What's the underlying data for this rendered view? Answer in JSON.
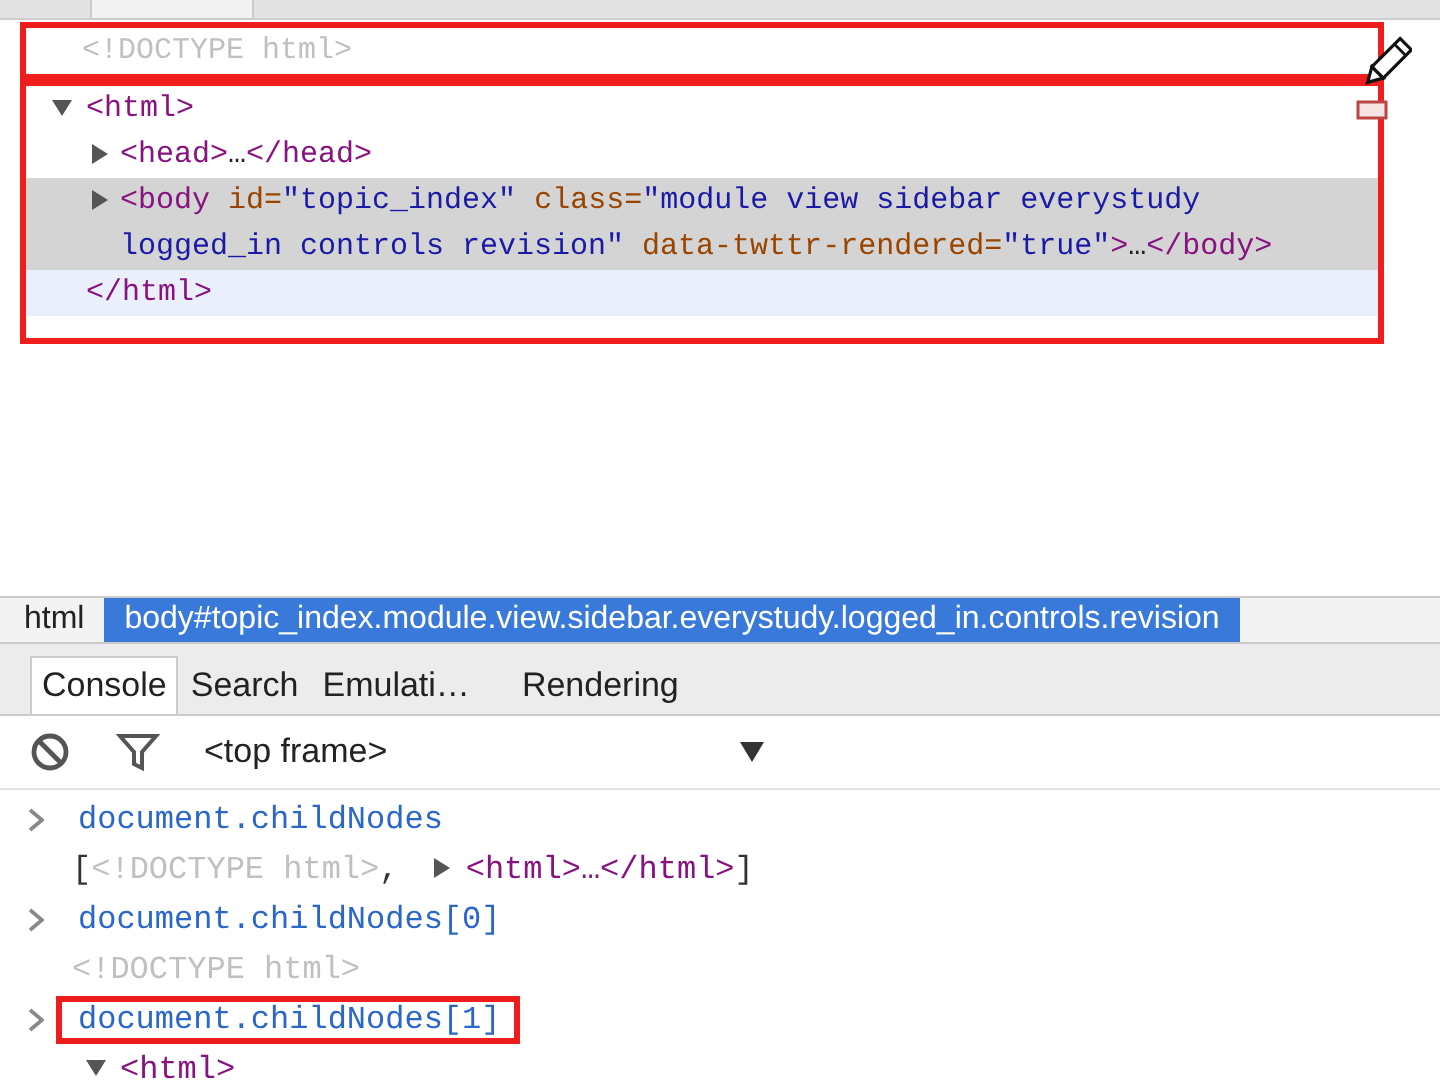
{
  "elements": {
    "nodes": [
      {
        "kind": "doctype",
        "text": "<!DOCTYPE html>",
        "boxed": true,
        "selected": false,
        "hovered": false
      },
      {
        "kind": "element",
        "boxed": true,
        "expanded": true,
        "selected": false,
        "hovered": false,
        "tokens": [
          {
            "kind": "tag",
            "text": "<html>"
          }
        ],
        "children": [
          {
            "kind": "element",
            "expanded": false,
            "selected": false,
            "hovered": false,
            "tokens": [
              {
                "kind": "tag",
                "text": "<head>"
              },
              {
                "kind": "plain",
                "text": "…"
              },
              {
                "kind": "tag",
                "text": "</head>"
              }
            ]
          },
          {
            "kind": "element",
            "expanded": false,
            "selected": true,
            "hovered": false,
            "tokens": [
              {
                "kind": "tag",
                "text": "<body"
              },
              {
                "kind": "attr",
                "text": " id="
              },
              {
                "kind": "value",
                "text": "\"topic_index\""
              },
              {
                "kind": "attr",
                "text": " class="
              },
              {
                "kind": "value",
                "text": "\"module view sidebar everystudy logged_in controls revision\""
              },
              {
                "kind": "attr",
                "text": " data-twttr-rendered="
              },
              {
                "kind": "value",
                "text": "\"true\""
              },
              {
                "kind": "tag",
                "text": ">"
              },
              {
                "kind": "plain",
                "text": "…"
              },
              {
                "kind": "tag",
                "text": "</body>"
              }
            ]
          }
        ],
        "closing": {
          "text": "</html>",
          "selected": false,
          "hovered": true
        }
      }
    ]
  },
  "breadcrumbs": [
    {
      "text": "html",
      "selected": false
    },
    {
      "text": "body#topic_index.module.view.sidebar.everystudy.logged_in.controls.revision",
      "selected": true
    }
  ],
  "tabs": [
    {
      "label": "Console",
      "selected": true
    },
    {
      "label": "Search",
      "selected": false
    },
    {
      "label": "Emulati…",
      "selected": false
    },
    {
      "label": "Rendering",
      "selected": false
    }
  ],
  "toolbar": {
    "frame": "<top frame>"
  },
  "console": [
    {
      "kind": "input",
      "text": "document.childNodes",
      "boxed": false
    },
    {
      "kind": "output",
      "tokens": [
        {
          "kind": "punct",
          "text": "["
        },
        {
          "kind": "doctype",
          "text": "<!DOCTYPE html>"
        },
        {
          "kind": "punct",
          "text": ", "
        },
        {
          "kind": "toggle",
          "expanded": false
        },
        {
          "kind": "tag",
          "text": "<html>…</html>"
        },
        {
          "kind": "punct",
          "text": "]"
        }
      ]
    },
    {
      "kind": "input",
      "text": "document.childNodes[0]",
      "boxed": false
    },
    {
      "kind": "output",
      "tokens": [
        {
          "kind": "doctype",
          "text": "<!DOCTYPE html>"
        }
      ]
    },
    {
      "kind": "input",
      "text": "document.childNodes[1]",
      "boxed": true
    },
    {
      "kind": "output",
      "tokens": [
        {
          "kind": "toggle",
          "expanded": true
        },
        {
          "kind": "tag",
          "text": "<html>"
        }
      ]
    }
  ]
}
